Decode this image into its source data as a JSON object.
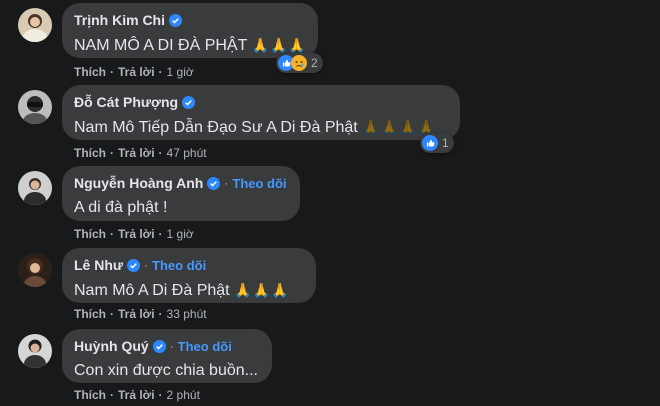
{
  "comments": [
    {
      "name": "Trịnh Kim Chi",
      "follow": "",
      "text": "NAM MÔ A DI ĐÀ PHẬT",
      "emoji": "🙏🙏🙏",
      "actions": {
        "like": "Thích",
        "reply": "Trả lời",
        "time": "1 giờ"
      },
      "reaction_count": "2",
      "reactions": [
        "like-icon",
        "sad-icon"
      ]
    },
    {
      "name": "Đỗ Cát Phượng",
      "follow": "",
      "text": "Nam Mô Tiếp Dẫn Đạo Sư A Di Đà Phật",
      "emoji": "🙏🙏🙏🙏",
      "actions": {
        "like": "Thích",
        "reply": "Trả lời",
        "time": "47 phút"
      },
      "reaction_count": "1",
      "reactions": [
        "like-icon"
      ]
    },
    {
      "name": "Nguyễn Hoàng Anh",
      "follow": "Theo dõi",
      "text": "A di đà phật !",
      "emoji": "",
      "actions": {
        "like": "Thích",
        "reply": "Trả lời",
        "time": "1 giờ"
      }
    },
    {
      "name": "Lê Như",
      "follow": "Theo dõi",
      "text": "Nam Mô A Di Đà Phật",
      "emoji": "🙏🙏🙏",
      "actions": {
        "like": "Thích",
        "reply": "Trả lời",
        "time": "33 phút"
      }
    },
    {
      "name": "Huỳnh Quý",
      "follow": "Theo dõi",
      "text": "Con xin được chia buồn...",
      "emoji": "",
      "actions": {
        "like": "Thích",
        "reply": "Trả lời",
        "time": "2 phút"
      }
    }
  ],
  "colors": {
    "background": "#18191a",
    "bubble": "#3a3b3c",
    "name": "#e4e6eb",
    "follow": "#4599ff",
    "verified": "#2d88ff",
    "meta": "#b0b3b8"
  },
  "separator": "·"
}
